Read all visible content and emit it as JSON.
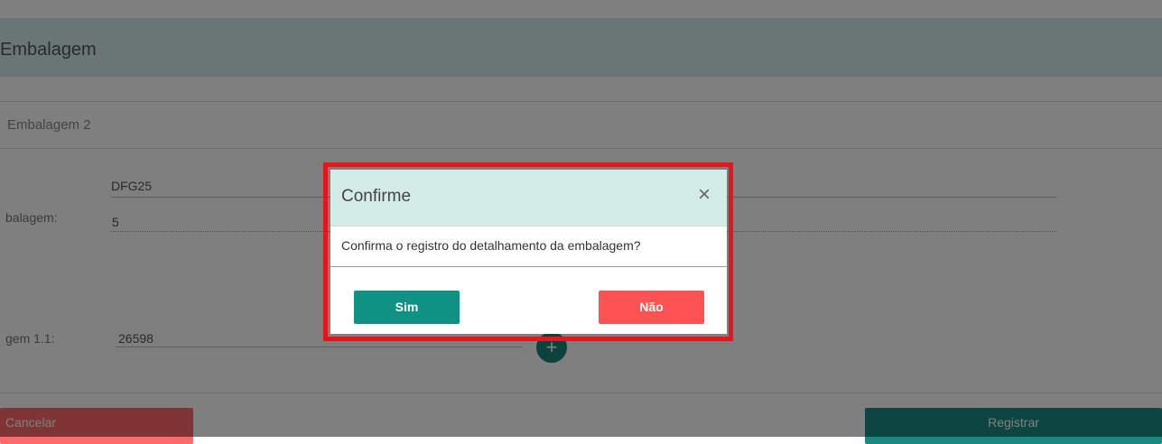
{
  "page": {
    "card_title": "Embalagem",
    "section_title": "Embalagem 2",
    "fields": {
      "code_value": "DFG25",
      "qty_label": "balagem:",
      "qty_value": "5",
      "sub_label": "gem 1.1:",
      "sub_value": "26598"
    },
    "add_button": "+",
    "cancel_label": "Cancelar",
    "register_label": "Registrar"
  },
  "modal": {
    "title": "Confirme",
    "close_icon": "×",
    "message": "Confirma o registro do detalhamento da embalagem?",
    "yes_label": "Sim",
    "no_label": "Não"
  },
  "colors": {
    "highlight": "#e8141c",
    "yes": "#0f9183",
    "no": "#fe5352"
  }
}
